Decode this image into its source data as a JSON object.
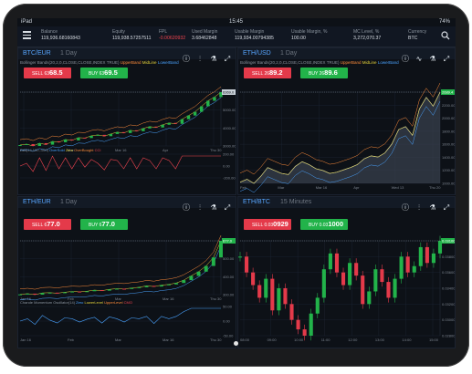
{
  "status": {
    "device": "iPad",
    "time": "15:45",
    "battery": "74%"
  },
  "account": [
    {
      "label": "Balance",
      "value": "119,936.68160843"
    },
    {
      "label": "Equity",
      "value": "119,938.57257511"
    },
    {
      "label": "FPL",
      "value": "-0.00620932",
      "negative": true
    },
    {
      "label": "Used Margin",
      "value": "3.68462848"
    },
    {
      "label": "Usable Margin",
      "value": "119,934.00794385"
    },
    {
      "label": "Usable Margin, %",
      "value": "100.00"
    },
    {
      "label": "MC Level, %",
      "value": "3,272,070.37"
    },
    {
      "label": "Currency",
      "value": "BTC"
    }
  ],
  "panels": [
    {
      "pair": "BTC/EUR",
      "timeframe": "1 Day",
      "legend": {
        "prefix": "Bollinger Bands(20,2,0,CLOSE,CLOSE,INDEX TRUE)",
        "upper": "UpperBand",
        "mid": "MidLine",
        "lower": "LowerBand"
      },
      "sell": {
        "label": "SELL",
        "small": "63",
        "big": "68.5"
      },
      "buy": {
        "label": "BUY",
        "small": "63",
        "big": "69.5"
      },
      "price_tag": "6369.0",
      "y_ticks": [
        "6000.00",
        "5000.00",
        "4000.00",
        "3000.00"
      ],
      "x_ticks": [
        "Feb",
        "Mar",
        "Mar 16",
        "Apr",
        "Thu 30"
      ],
      "sub_legend": {
        "prefix": "CCI(14,100,-100)",
        "over": "OverSold",
        "zero": "Zero",
        "overbought": "OverBought",
        "main": "CCI"
      },
      "sub_ticks": [
        "200.00",
        "0.00",
        "-200.00"
      ],
      "sub_x_ticks": [
        "Feb",
        "Mar",
        "Mar 16",
        "Apr",
        "Thu 30"
      ],
      "chart_data": {
        "type": "line",
        "values": [
          3500,
          3550,
          3450,
          3600,
          3520,
          3700,
          3650,
          3800,
          3750,
          3900,
          3880,
          4000,
          4050,
          3980,
          4100,
          4200,
          4150,
          4300,
          4250,
          4400,
          4500,
          4450,
          4600,
          4700,
          4650,
          4900,
          5100,
          5300,
          5600,
          5900,
          6100,
          6369
        ]
      }
    },
    {
      "pair": "ETH/USD",
      "timeframe": "1 Day",
      "legend": {
        "prefix": "Bollinger Bands(20,2,0,CLOSE,CLOSE,INDEX TRUE)",
        "upper": "UpperBand",
        "mid": "MidLine",
        "lower": "LowerBand"
      },
      "sell": {
        "label": "SELL",
        "small": "26",
        "big": "89.2"
      },
      "buy": {
        "label": "BUY",
        "small": "26",
        "big": "89.6"
      },
      "price_tag": "2689.4",
      "y_ticks": [
        "2400.00",
        "2200.00",
        "2000.00",
        "1800.00",
        "1600.00",
        "1400.00",
        "1200.00",
        "1000.00"
      ],
      "x_ticks": [
        "Feb",
        "Mar",
        "Mar 16",
        "Apr",
        "Wed 13",
        "Thu 20"
      ],
      "chart_data": {
        "type": "area",
        "values": [
          1150,
          1200,
          1130,
          1250,
          1400,
          1350,
          1300,
          1280,
          1420,
          1500,
          1450,
          1380,
          1350,
          1300,
          1320,
          1360,
          1400,
          1450,
          1550,
          1600,
          1580,
          1650,
          1800,
          2050,
          2100,
          1950,
          2400,
          2600,
          2450,
          2689
        ]
      }
    },
    {
      "pair": "ETH/EUR",
      "timeframe": "1 Day",
      "legend": null,
      "sell": {
        "label": "SELL",
        "small": "6",
        "big": "77.0"
      },
      "buy": {
        "label": "BUY",
        "small": "6",
        "big": "77.0"
      },
      "price_tag": "677.0",
      "y_ticks": [
        "600.00",
        "500.00",
        "400.00",
        "300.00"
      ],
      "x_ticks": [
        "Jan 16",
        "Feb",
        "Mar",
        "Mar 16",
        "Thu 30"
      ],
      "sub_legend": {
        "prefix": "Chande Momentum Oscillator(14)",
        "zero": "Zero",
        "lower": "LowerLevel",
        "upper": "UpperLevel",
        "main": "CMO"
      },
      "sub_ticks": [
        "50.00",
        "0.00",
        "-50.00"
      ],
      "sub_x_ticks": [
        "Jan 16",
        "Feb",
        "Mar",
        "Mar 16",
        "Thu 30"
      ],
      "chart_data": {
        "type": "line",
        "values": [
          300,
          305,
          298,
          310,
          312,
          308,
          315,
          320,
          318,
          322,
          330,
          326,
          335,
          340,
          338,
          345,
          350,
          360,
          355,
          365,
          370,
          380,
          400,
          430,
          460,
          500,
          560,
          677
        ]
      }
    },
    {
      "pair": "ETH/BTC",
      "timeframe": "15 Minutes",
      "legend": null,
      "sell": {
        "label": "SELL",
        "small": "0.03",
        "big": "0929"
      },
      "buy": {
        "label": "BUY",
        "small": "0.03",
        "big": "1000"
      },
      "price_tag": "0.031000",
      "y_ticks": [
        "0.040000",
        "0.038000",
        "0.036000",
        "0.034000",
        "0.032000",
        "0.030000",
        "0.028000"
      ],
      "x_ticks": [
        "08:00",
        "09:00",
        "10:00",
        "11:00",
        "12:00",
        "13:00",
        "14:00",
        "15:00"
      ],
      "chart_data": {
        "type": "bar",
        "values": [
          0.0305,
          0.03,
          0.0296,
          0.0292,
          0.0298,
          0.0288,
          0.0295,
          0.029,
          0.0285,
          0.0282,
          0.028,
          0.0287,
          0.0292,
          0.0301,
          0.0306,
          0.03,
          0.0296,
          0.0303,
          0.0299,
          0.029,
          0.0294,
          0.0301,
          0.0297,
          0.0292,
          0.0298,
          0.0305,
          0.03,
          0.0302,
          0.0308,
          0.0303,
          0.0306,
          0.031
        ]
      }
    }
  ],
  "colors": {
    "sell": "#e43a4a",
    "buy": "#22b34a",
    "accent": "#58a6ff",
    "bg": "#0d1117"
  }
}
